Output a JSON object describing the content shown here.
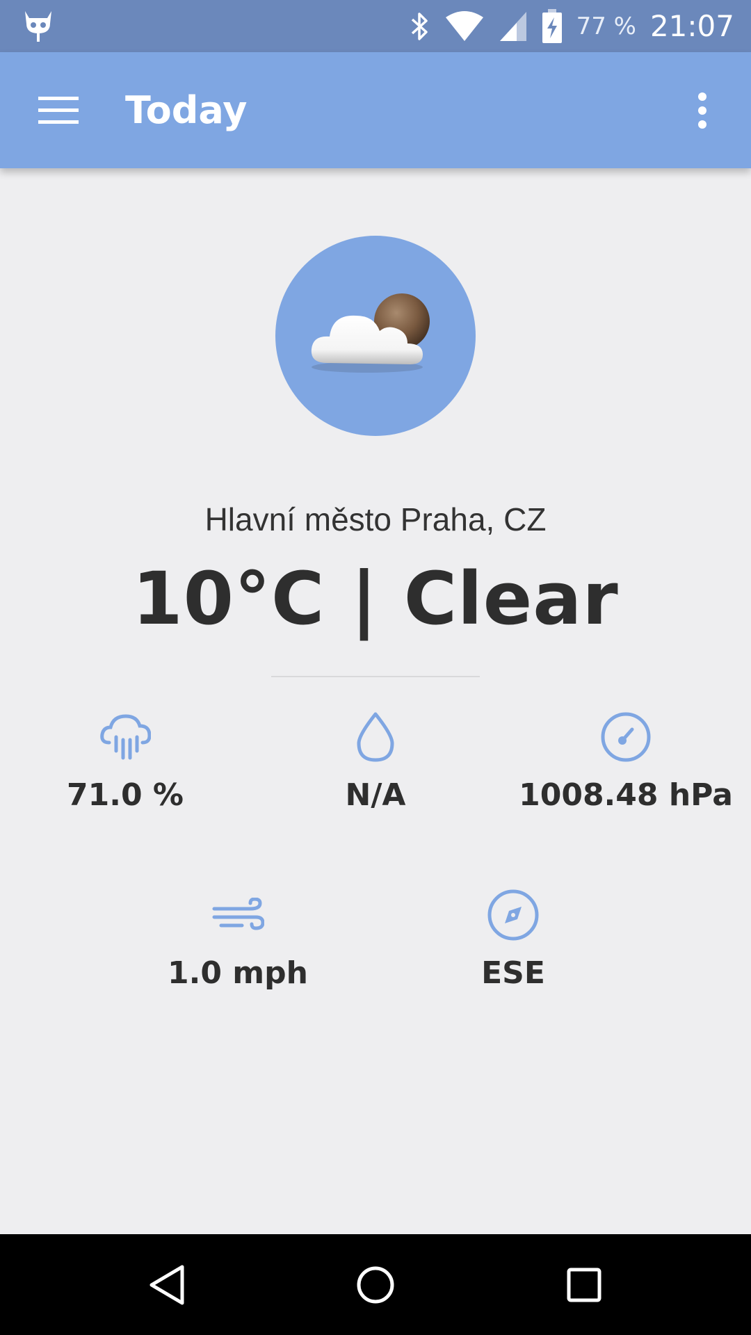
{
  "status_bar": {
    "battery_percent": "77 %",
    "time": "21:07"
  },
  "toolbar": {
    "title": "Today"
  },
  "weather": {
    "location": "Hlavní město Praha, CZ",
    "headline": "10°C | Clear"
  },
  "stats": {
    "humidity": "71.0 %",
    "precipitation": "N/A",
    "pressure": "1008.48 hPa",
    "wind_speed": "1.0 mph",
    "wind_direction": "ESE"
  },
  "colors": {
    "status_bar": "#6B88BB",
    "toolbar": "#7FA6E2",
    "accent_icon": "#7FA6E2",
    "background": "#EEEEF0",
    "text": "#2E2E2E"
  },
  "icons": {
    "status_left": "cyanogen-bugdroid-icon",
    "bluetooth": "bluetooth-icon",
    "wifi": "wifi-icon",
    "signal": "signal-icon",
    "battery": "battery-charging-icon",
    "menu": "hamburger-menu-icon",
    "overflow": "more-vert-icon",
    "weather": "cloud-moon-icon",
    "humidity": "rain-cloud-icon",
    "precipitation": "water-drop-icon",
    "pressure": "gauge-icon",
    "wind": "wind-icon",
    "direction": "compass-icon"
  }
}
